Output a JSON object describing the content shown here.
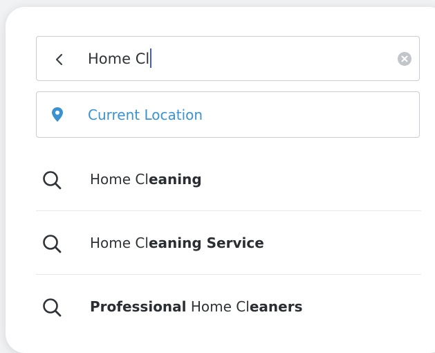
{
  "search": {
    "query": "Home Cl",
    "icons": {
      "back": "chevron-left-icon",
      "clear": "clear-circle-icon"
    }
  },
  "location": {
    "label": "Current Location",
    "icon": "map-pin-icon",
    "color": "#3a93d0"
  },
  "suggestions": [
    {
      "parts": [
        {
          "text": "Home Cl",
          "bold": false
        },
        {
          "text": "eaning",
          "bold": true
        }
      ]
    },
    {
      "parts": [
        {
          "text": "Home Cl",
          "bold": false
        },
        {
          "text": "eaning Service",
          "bold": true
        }
      ]
    },
    {
      "parts": [
        {
          "text": "Professional",
          "bold": true
        },
        {
          "text": " Home Cl",
          "bold": false
        },
        {
          "text": "eaners",
          "bold": true
        }
      ]
    }
  ],
  "suggestion_icon": "search-icon",
  "colors": {
    "caret": "#3b5bdb",
    "text": "#2f3338",
    "border": "#c9ccd1"
  }
}
